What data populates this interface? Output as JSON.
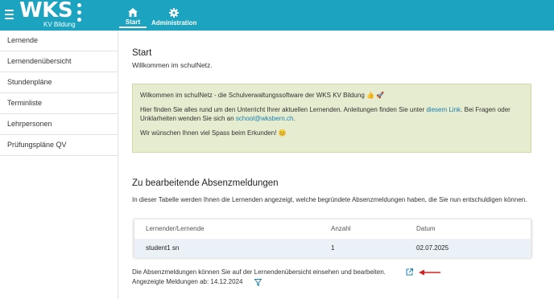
{
  "header": {
    "logo_text": "WKS",
    "logo_sub": "KV Bildung",
    "nav": [
      {
        "label": "Start",
        "icon": "home-icon"
      },
      {
        "label": "Administration",
        "icon": "gear-icon"
      }
    ]
  },
  "sidebar": {
    "items": [
      {
        "label": "Lernende"
      },
      {
        "label": "Lernendenübersicht"
      },
      {
        "label": "Stundenpläne"
      },
      {
        "label": "Terminliste"
      },
      {
        "label": "Lehrpersonen"
      },
      {
        "label": "Prüfungspläne QV"
      }
    ]
  },
  "main": {
    "title": "Start",
    "subtitle": "Willkommen im schulNetz.",
    "welcome": {
      "line1": "Wilkommen im schulNetz - die Schulverwaltungssoftware der WKS KV Bildung 👍 🚀",
      "line2_part1": "Hier finden Sie alles rund um den Unterricht Ihrer aktuellen Lernenden. Anleitungen finden Sie unter ",
      "line2_link": "diesem Link",
      "line2_part2": ". Bei Fragen oder Unklarheiten wenden Sie sich an ",
      "line2_email": "school@wksbern.ch",
      "line2_end": ".",
      "line3": "Wir wünschen Ihnen viel Spass beim Erkunden! 😊"
    },
    "absences": {
      "title": "Zu bearbeitende Absenzmeldungen",
      "description": "In dieser Tabelle werden Ihnen die Lernenden angezeigt, welche begründete Absenzmeldungen haben, die Sie nun entschuldigen können.",
      "columns": [
        "Lernender/Lernende",
        "Anzahl",
        "Datum"
      ],
      "rows": [
        {
          "name": "student1 sn",
          "count": "1",
          "date": "02.07.2025"
        }
      ],
      "footer_text": "Die Absenzmeldungen können Sie auf der Lernendenübersicht einsehen und bearbeiten.",
      "shown_since": "Angezeigte Meldungen ab: 14.12.2024"
    }
  },
  "colors": {
    "header_bg": "#1ba3bf",
    "welcome_bg": "#e6eccf",
    "link": "#1a7fb1",
    "arrow": "#d42020"
  }
}
